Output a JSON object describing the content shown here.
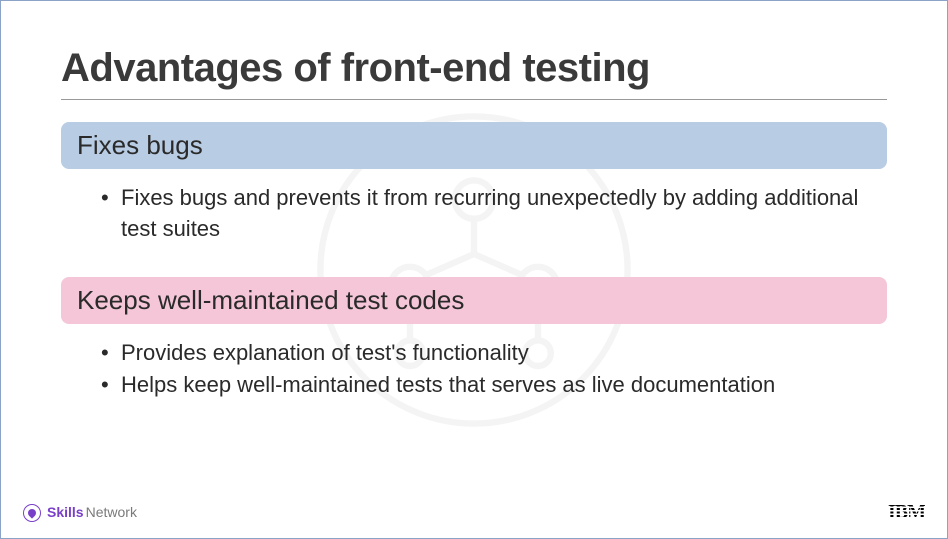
{
  "title": "Advantages of front-end testing",
  "sections": {
    "0": {
      "header": "Fixes bugs",
      "bullets": {
        "0": "Fixes bugs and prevents it from recurring unexpectedly by adding additional test suites"
      }
    },
    "1": {
      "header": "Keeps well-maintained test codes",
      "bullets": {
        "0": "Provides explanation of test's functionality",
        "1": "Helps keep well-maintained tests that serves as live documentation"
      }
    }
  },
  "footer": {
    "skills": "Skills",
    "network": "Network",
    "ibm": "IBM"
  }
}
